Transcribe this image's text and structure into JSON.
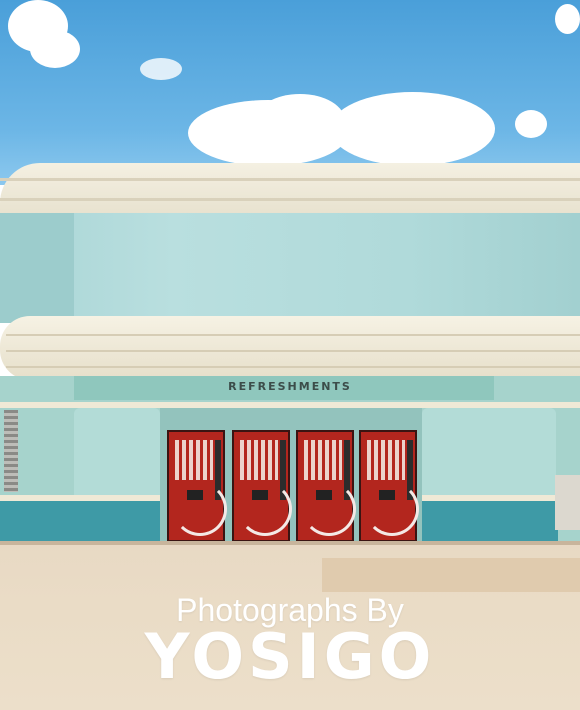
{
  "sign": {
    "text": "REFRESHMENTS"
  },
  "caption": {
    "subtitle": "Photographs By",
    "title": "YOSIGO"
  },
  "colors": {
    "sky": "#5aa8de",
    "wall_mint": "#a6d3cc",
    "teal_foot": "#3e9aa6",
    "cream": "#efe9d6",
    "vending_red": "#b3261e",
    "ground": "#e8d9c4",
    "text": "#ffffff"
  },
  "vending_machines": [
    {
      "icon": "vending-machine"
    },
    {
      "icon": "vending-machine"
    },
    {
      "icon": "vending-machine"
    },
    {
      "icon": "vending-machine"
    }
  ]
}
